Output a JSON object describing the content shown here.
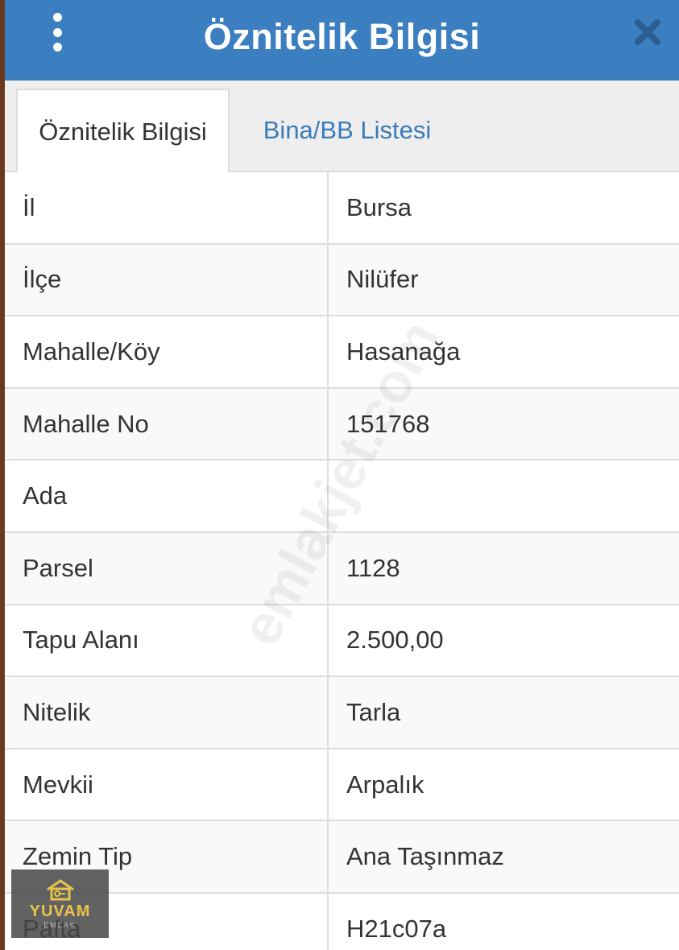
{
  "header": {
    "title": "Öznitelik Bilgisi",
    "menu_icon": "kebab-menu-icon",
    "close_icon": "close-icon",
    "bg_color": "#3c7fc1"
  },
  "tabs": [
    {
      "label": "Öznitelik Bilgisi",
      "active": true
    },
    {
      "label": "Bina/BB Listesi",
      "active": false
    }
  ],
  "rows": [
    {
      "label": "İl",
      "value": "Bursa"
    },
    {
      "label": "İlçe",
      "value": "Nilüfer"
    },
    {
      "label": "Mahalle/Köy",
      "value": "Hasanağa"
    },
    {
      "label": "Mahalle No",
      "value": "151768"
    },
    {
      "label": "Ada",
      "value": ""
    },
    {
      "label": "Parsel",
      "value": "1128"
    },
    {
      "label": "Tapu Alanı",
      "value": "2.500,00"
    },
    {
      "label": "Nitelik",
      "value": "Tarla"
    },
    {
      "label": "Mevkii",
      "value": "Arpalık"
    },
    {
      "label": "Zemin Tip",
      "value": "Ana Taşınmaz"
    },
    {
      "label": "Pafta",
      "value": "H21c07a"
    }
  ],
  "watermark": "emlakjet.com",
  "logo": {
    "text": "YUVAM",
    "sub": "EMLAK",
    "icon": "house-key-icon"
  },
  "colors": {
    "tab_link": "#3a7bb8",
    "border": "#dddddd",
    "text": "#333333"
  }
}
